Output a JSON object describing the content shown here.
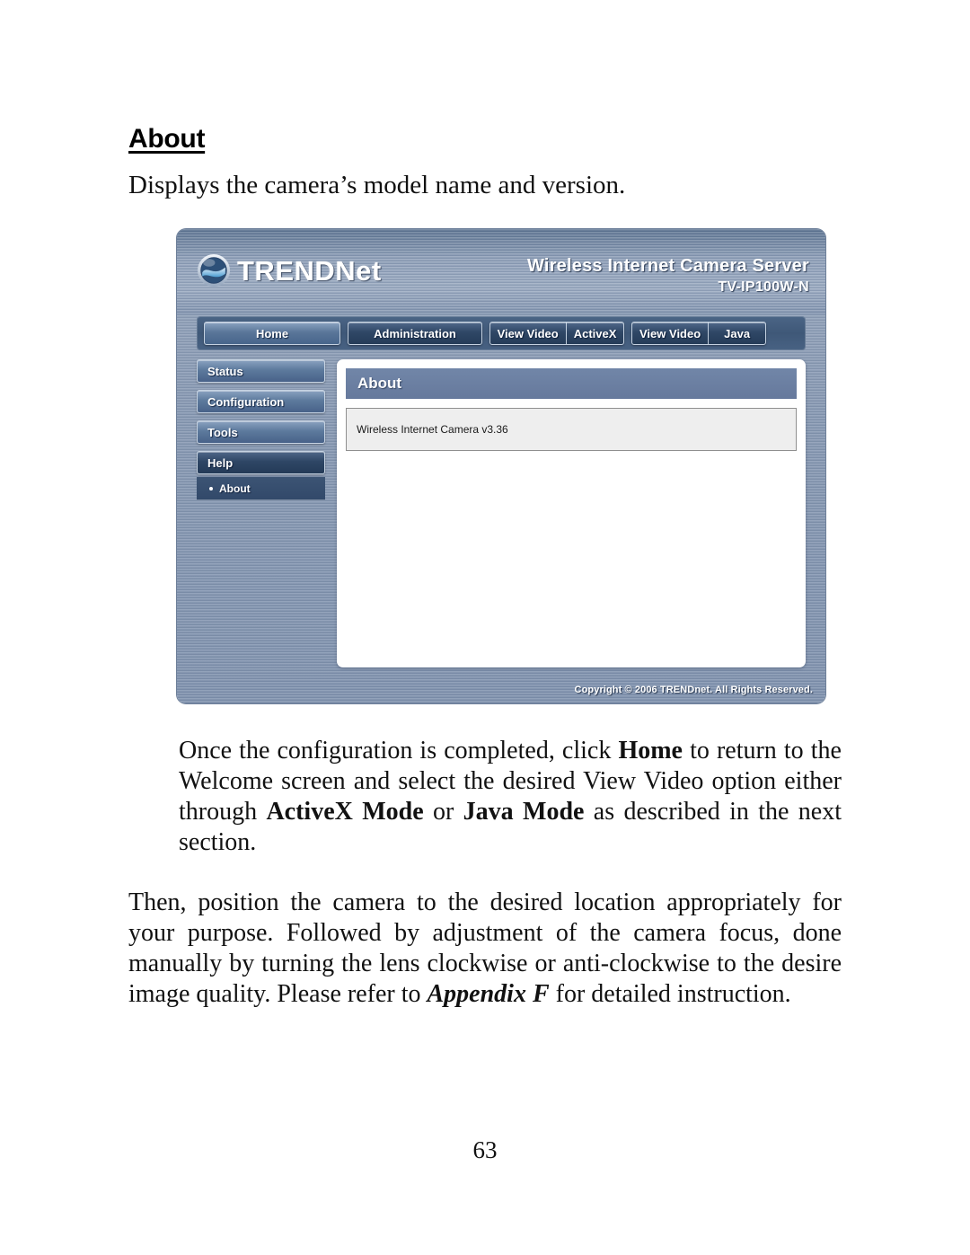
{
  "document": {
    "section_heading": "About",
    "intro_line": "Displays the camera’s model name and version.",
    "page_number": "63"
  },
  "camera_ui": {
    "brand": {
      "logo_icon": "trendnet-globe-icon",
      "name_upper": "TRENDN",
      "name_lower": "et",
      "full_name": "TRENDnet"
    },
    "product": {
      "title": "Wireless Internet Camera Server",
      "model": "TV-IP100W-N"
    },
    "nav": {
      "home": "Home",
      "administration": "Administration",
      "view_video_1": "View Video",
      "activex": "ActiveX",
      "view_video_2": "View Video",
      "java": "Java"
    },
    "sidebar": {
      "items": [
        {
          "label": "Status",
          "active": false
        },
        {
          "label": "Configuration",
          "active": false
        },
        {
          "label": "Tools",
          "active": false
        },
        {
          "label": "Help",
          "active": true
        }
      ],
      "sub_item": {
        "label": "About",
        "bullet_icon": "bullet-dot-icon"
      }
    },
    "panel": {
      "title": "About",
      "info_text": "Wireless Internet Camera v3.36"
    },
    "footer": {
      "copyright": "Copyright © 2006 TRENDnet. All Rights Reserved."
    },
    "colors": {
      "chrome_blue": "#8496b1",
      "nav_bar": "#3f5878",
      "panel_title": "#6b7fa3",
      "button_light": "#5a7699",
      "button_active": "#2f4766",
      "info_box_bg": "#eeeeee"
    }
  },
  "body": {
    "paragraph_1": {
      "t1": "Once the configuration is completed, click ",
      "b1": "Home",
      "t2": " to return to the Welcome screen and select the desired View Video option either through ",
      "b2": "ActiveX Mode",
      "t3": " or ",
      "b3": "Java Mode",
      "t4": " as described in the next section."
    },
    "paragraph_2": {
      "t1": "Then, position the camera to the desired location appropriately for your purpose.  Followed by adjustment of the camera focus, done manually by turning the lens clockwise or anti-clockwise to the desire image quality.  Please refer to ",
      "i1": "Appendix F",
      "t2": " for detailed instruction."
    }
  }
}
